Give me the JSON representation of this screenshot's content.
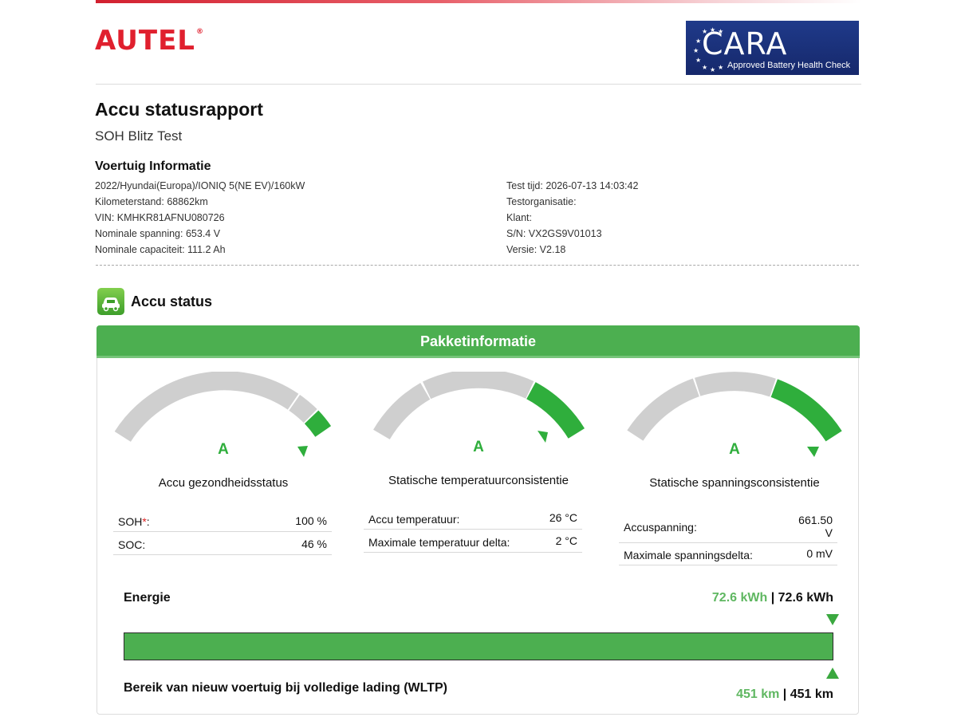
{
  "header": {
    "brand": "AUTEL",
    "brand_mark": "®",
    "badge": {
      "title": "CARA",
      "subtitle": "Approved Battery Health Check"
    }
  },
  "report": {
    "title": "Accu statusrapport",
    "subtitle": "SOH Blitz Test"
  },
  "vehicle": {
    "heading": "Voertuig Informatie",
    "left": [
      "2022/Hyundai(Europa)/IONIQ 5(NE EV)/160kW",
      "Kilometerstand: 68862km",
      "VIN: KMHKR81AFNU080726",
      "Nominale spanning: 653.4 V",
      "Nominale capaciteit: 111.2 Ah"
    ],
    "right": [
      "Test tijd: 2026-07-13 14:03:42",
      "Testorganisatie:",
      "Klant:",
      "S/N: VX2GS9V01013",
      "Versie: V2.18"
    ]
  },
  "section": {
    "icon": "battery-car-icon",
    "title": "Accu status",
    "panel_title": "Pakketinformatie"
  },
  "colors": {
    "accent": "#4caf50",
    "gauge_green": "#2fae3c",
    "gauge_grey": "#cfcfcf",
    "brand_red": "#e0202e"
  },
  "gauges": [
    {
      "grade": "A",
      "label": "Accu gezondheidsstatus",
      "rows": [
        {
          "key": "SOH",
          "required_mark": "*",
          "suffix": ":",
          "value": "100 %"
        },
        {
          "key": "SOC:",
          "value": "46 %"
        }
      ]
    },
    {
      "grade": "A",
      "label": "Statische temperatuurconsistentie",
      "rows": [
        {
          "key": "Accu temperatuur:",
          "value": "26 °C"
        },
        {
          "key": "Maximale temperatuur delta:",
          "value": "2 °C"
        }
      ]
    },
    {
      "grade": "A",
      "label": "Statische spanningsconsistentie",
      "rows": [
        {
          "key": "Accuspanning:",
          "value": "661.50",
          "value2": "V"
        },
        {
          "key": "Maximale spanningsdelta:",
          "value": "0 mV"
        }
      ]
    }
  ],
  "energy": {
    "label": "Energie",
    "current": "72.6 kWh",
    "separator": "|",
    "nominal": "72.6 kWh",
    "fraction": 1.0
  },
  "range": {
    "label": "Bereik van nieuw voertuig bij volledige lading (WLTP)",
    "current": "451 km",
    "separator": "|",
    "nominal": "451 km"
  }
}
